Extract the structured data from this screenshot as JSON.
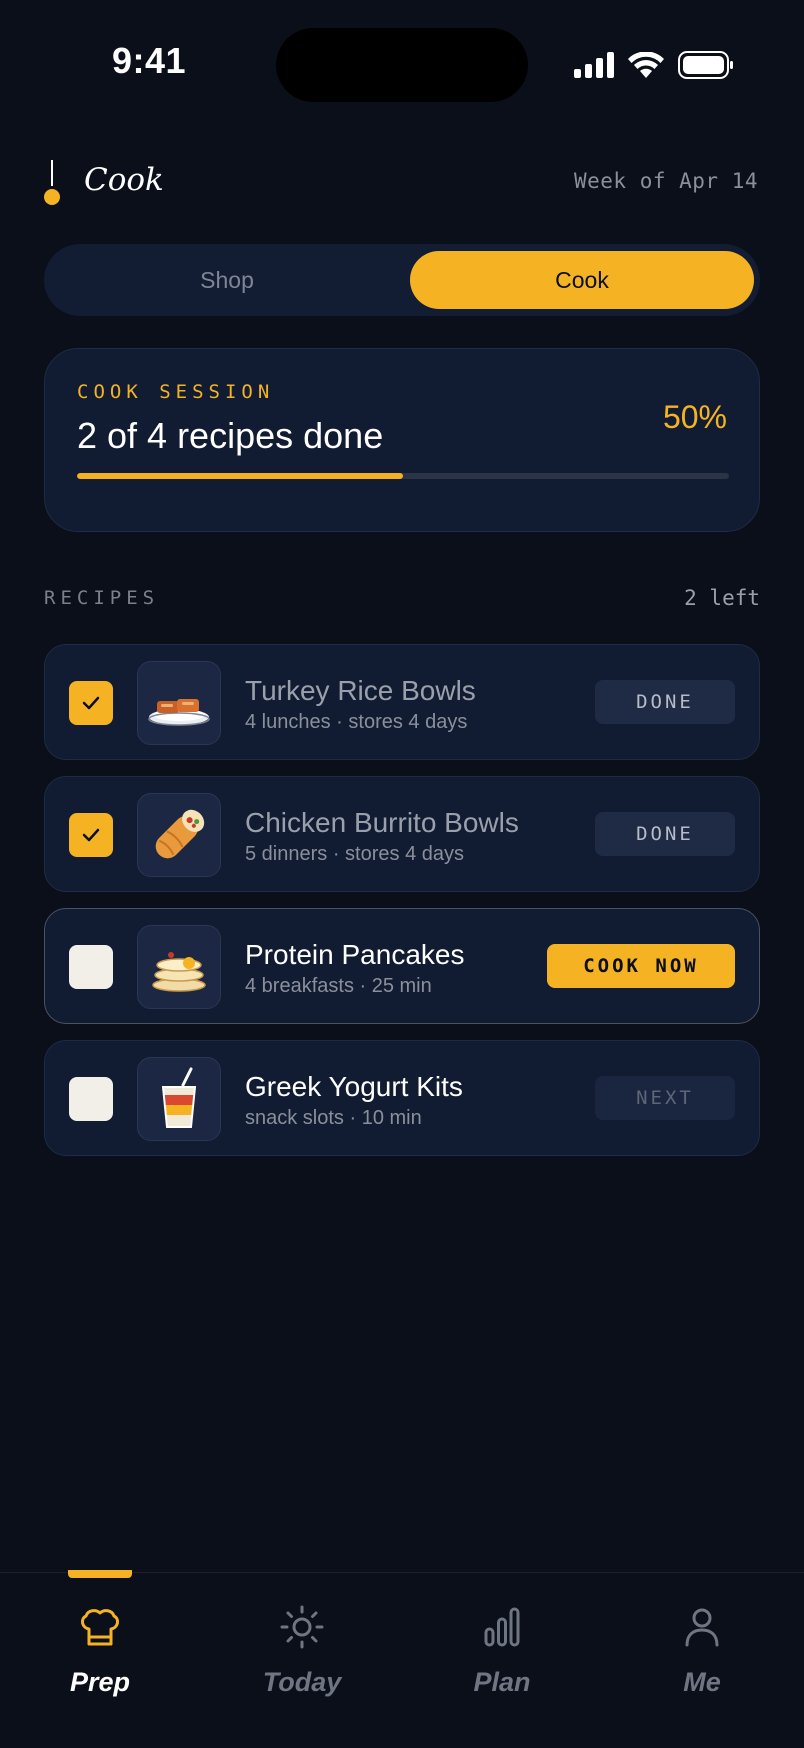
{
  "status_bar": {
    "time": "9:41"
  },
  "header": {
    "title": "Cook",
    "week": "Week of Apr 14"
  },
  "segmented": {
    "options": [
      "Shop",
      "Cook"
    ],
    "selected": "Cook"
  },
  "session": {
    "label": "COOK SESSION",
    "title": "2 of 4 recipes done",
    "percent_label": "50%",
    "progress": 0.5
  },
  "recipes": {
    "label": "RECIPES",
    "count": "2 left",
    "items": [
      {
        "name": "Turkey Rice Bowls",
        "meta": "4 lunches · stores 4 days",
        "checked": true,
        "action": "DONE",
        "icon": "rice-bowl-icon"
      },
      {
        "name": "Chicken Burrito Bowls",
        "meta": "5 dinners · stores 4 days",
        "checked": true,
        "action": "DONE",
        "icon": "burrito-icon"
      },
      {
        "name": "Protein Pancakes",
        "meta": "4 breakfasts · 25 min",
        "checked": false,
        "action": "COOK NOW",
        "icon": "pancakes-icon"
      },
      {
        "name": "Greek Yogurt Kits",
        "meta": "snack slots · 10 min",
        "checked": false,
        "action": "NEXT",
        "icon": "yogurt-cup-icon"
      }
    ]
  },
  "nav": {
    "items": [
      {
        "label": "Prep",
        "icon": "chef-hat-icon",
        "active": true
      },
      {
        "label": "Today",
        "icon": "sun-icon",
        "active": false
      },
      {
        "label": "Plan",
        "icon": "bar-chart-icon",
        "active": false
      },
      {
        "label": "Me",
        "icon": "person-icon",
        "active": false
      }
    ]
  },
  "colors": {
    "accent": "#f5b324",
    "background": "#0a0f19",
    "card": "#111c33"
  }
}
